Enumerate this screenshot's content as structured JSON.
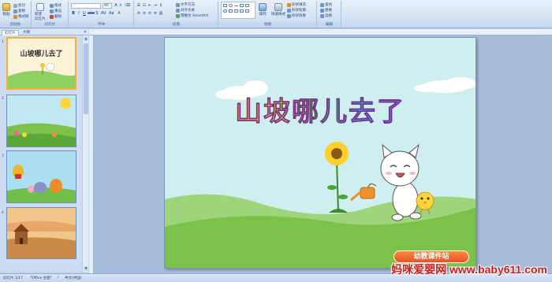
{
  "ribbon": {
    "groups": [
      {
        "title": "剪贴板"
      },
      {
        "title": "幻灯片"
      },
      {
        "title": "字体"
      },
      {
        "title": "段落"
      },
      {
        "title": "绘图"
      },
      {
        "title": "编辑"
      }
    ],
    "paste_label": "粘贴",
    "cut_label": "剪切",
    "copy_label": "复制",
    "format_painter_label": "格式刷",
    "new_slide_label": "新建\n幻灯片",
    "layout_label": "版式",
    "reset_label": "重设",
    "delete_label": "删除",
    "font_size_value": "40",
    "text_direction_label": "文字方向",
    "align_text_label": "对齐文本",
    "smartart_label": "转换为 SmartArt",
    "arrange_label": "排列",
    "quick_styles_label": "快速样式",
    "shape_fill_label": "形状填充",
    "shape_outline_label": "形状轮廓",
    "shape_effects_label": "形状效果",
    "find_label": "查找",
    "replace_label": "替换",
    "select_label": "选择"
  },
  "left_panel": {
    "tab_slides": "幻灯片",
    "tab_outline": "大纲",
    "close_icon": "close-icon",
    "thumbnails": [
      {
        "number": "1",
        "title": "山坡哪儿去了",
        "selected": true
      },
      {
        "number": "2"
      },
      {
        "number": "3"
      },
      {
        "number": "4"
      }
    ]
  },
  "slide": {
    "title": "山坡哪儿去了",
    "badge_text": "幼教课件站"
  },
  "status_bar": {
    "slide_counter": "幻灯片 1/17",
    "theme": "\"Office 主题\"",
    "language": "中文(中国)"
  },
  "watermark": "妈咪爱婴网 www.baby611.com",
  "colors": {
    "sky": "#cfeef0",
    "grass": "#7cc24a",
    "ribbon_bg": "#d6e4f5",
    "workspace": "#a7bcd9"
  }
}
